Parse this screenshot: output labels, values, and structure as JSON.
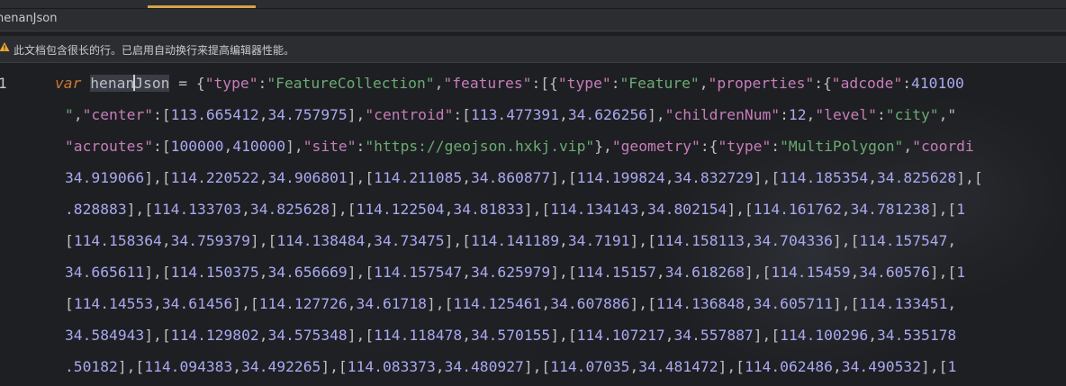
{
  "breadcrumb": "henanJson",
  "warning": {
    "icon": "warning-icon",
    "text": "此文档包含很长的行。已启用自动换行来提高编辑器性能。"
  },
  "editor": {
    "line_number": "1",
    "line1": {
      "kw": "var",
      "ident_a": "henan",
      "ident_b": "Json",
      "op": " = ",
      "p1": "{",
      "k1": "\"type\"",
      "c1": ":",
      "s1": "\"FeatureCollection\"",
      "c2": ",",
      "k2": "\"features\"",
      "c3": ":[{",
      "k3": "\"type\"",
      "c4": ":",
      "s2": "\"Feature\"",
      "c5": ",",
      "k4": "\"properties\"",
      "c6": ":{",
      "k5": "\"adcode\"",
      "c7": ":",
      "n1": "410100"
    },
    "line2": {
      "s0": "\"",
      "c0": ",",
      "k1": "\"center\"",
      "c1": ":[",
      "n1": "113.665412",
      "c2": ",",
      "n2": "34.757975",
      "c3": "],",
      "k2": "\"centroid\"",
      "c4": ":[",
      "n3": "113.477391",
      "c5": ",",
      "n4": "34.626256",
      "c6": "],",
      "k3": "\"childrenNum\"",
      "c7": ":",
      "n5": "12",
      "c8": ",",
      "k4": "\"level\"",
      "c9": ":",
      "s1": "\"city\"",
      "c10": ",\""
    },
    "line3": {
      "k1": "\"acroutes\"",
      "c1": ":[",
      "n1": "100000",
      "c2": ",",
      "n2": "410000",
      "c3": "],",
      "k2": "\"site\"",
      "c4": ":",
      "s1": "\"https://geojson.hxkj.vip\"",
      "c5": "},",
      "k3": "\"geometry\"",
      "c6": ":{",
      "k4": "\"type\"",
      "c7": ":",
      "s2": "\"MultiPolygon\"",
      "c8": ",",
      "k5": "\"coordi"
    },
    "coord_lines": [
      "34.919066],[114.220522,34.906801],[114.211085,34.860877],[114.199824,34.832729],[114.185354,34.825628],[",
      ".828883],[114.133703,34.825628],[114.122504,34.81833],[114.134143,34.802154],[114.161762,34.781238],[1",
      "[114.158364,34.759379],[114.138484,34.73475],[114.141189,34.7191],[114.158113,34.704336],[114.157547,",
      "34.665611],[114.150375,34.656669],[114.157547,34.625979],[114.15157,34.618268],[114.15459,34.60576],[1",
      "[114.14553,34.61456],[114.127726,34.61718],[114.125461,34.607886],[114.136848,34.605711],[114.133451,",
      "34.584943],[114.129802,34.575348],[114.118478,34.570155],[114.107217,34.557887],[114.100296,34.535178",
      ".50182],[114.094383,34.492265],[114.083373,34.480927],[114.07035,34.481472],[114.062486,34.490532],[1"
    ]
  }
}
